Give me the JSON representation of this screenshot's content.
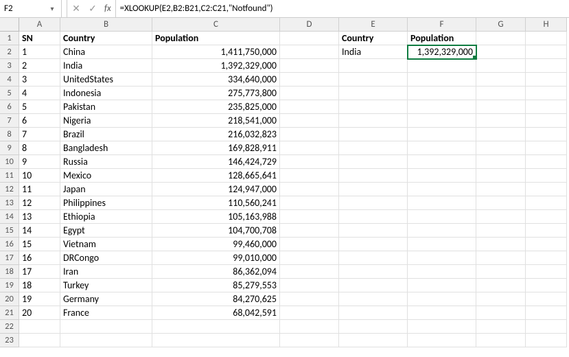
{
  "formula_bar": {
    "name_box": "F2",
    "formula": "=XLOOKUP(E2,B2:B21,C2:C21,\"Notfound\")",
    "fx_label": "fx"
  },
  "columns": [
    "A",
    "B",
    "C",
    "D",
    "E",
    "F",
    "G",
    "H"
  ],
  "row_count": 23,
  "headers": {
    "A": "SN",
    "B": "Country",
    "C": "Population",
    "E": "Country",
    "F": "Population"
  },
  "rows": [
    {
      "sn": "1",
      "country": "China",
      "population": "1,411,750,000"
    },
    {
      "sn": "2",
      "country": "India",
      "population": "1,392,329,000"
    },
    {
      "sn": "3",
      "country": "UnitedStates",
      "population": "334,640,000"
    },
    {
      "sn": "4",
      "country": "Indonesia",
      "population": "275,773,800"
    },
    {
      "sn": "5",
      "country": "Pakistan",
      "population": "235,825,000"
    },
    {
      "sn": "6",
      "country": "Nigeria",
      "population": "218,541,000"
    },
    {
      "sn": "7",
      "country": "Brazil",
      "population": "216,032,823"
    },
    {
      "sn": "8",
      "country": "Bangladesh",
      "population": "169,828,911"
    },
    {
      "sn": "9",
      "country": "Russia",
      "population": "146,424,729"
    },
    {
      "sn": "10",
      "country": "Mexico",
      "population": "128,665,641"
    },
    {
      "sn": "11",
      "country": "Japan",
      "population": "124,947,000"
    },
    {
      "sn": "12",
      "country": "Philippines",
      "population": "110,560,241"
    },
    {
      "sn": "13",
      "country": "Ethiopia",
      "population": "105,163,988"
    },
    {
      "sn": "14",
      "country": "Egypt",
      "population": "104,700,708"
    },
    {
      "sn": "15",
      "country": "Vietnam",
      "population": "99,460,000"
    },
    {
      "sn": "16",
      "country": "DRCongo",
      "population": "99,010,000"
    },
    {
      "sn": "17",
      "country": "Iran",
      "population": "86,362,094"
    },
    {
      "sn": "18",
      "country": "Turkey",
      "population": "85,279,553"
    },
    {
      "sn": "19",
      "country": "Germany",
      "population": "84,270,625"
    },
    {
      "sn": "20",
      "country": "France",
      "population": "68,042,591"
    }
  ],
  "lookup": {
    "country": "India",
    "population": "1,392,329,000"
  },
  "active_cell": "F2"
}
